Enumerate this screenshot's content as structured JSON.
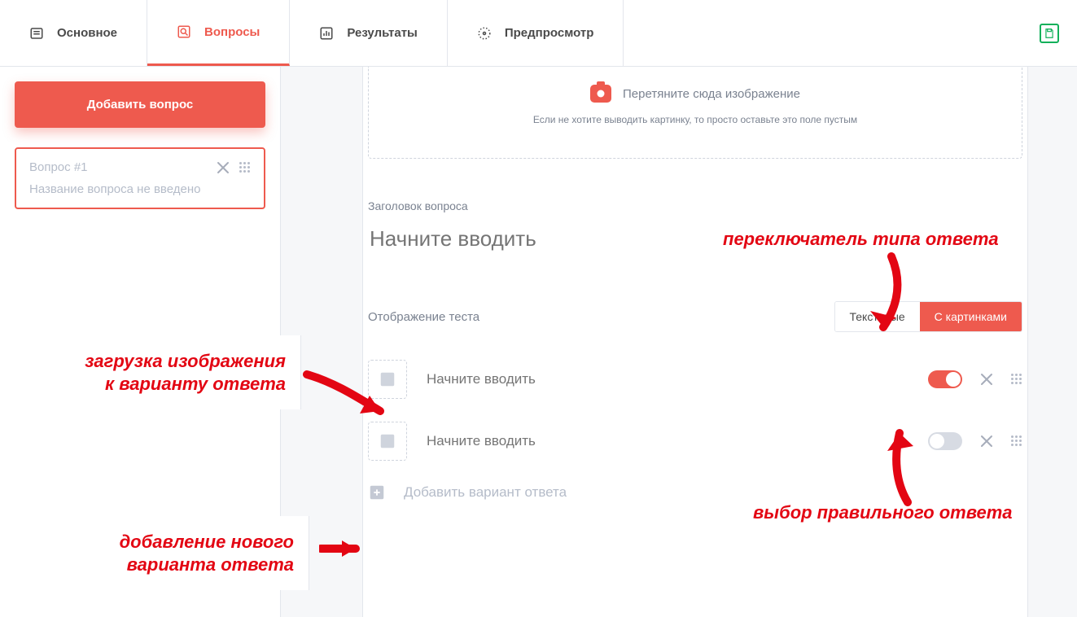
{
  "tabs": {
    "main": "Основное",
    "questions": "Вопросы",
    "results": "Результаты",
    "preview": "Предпросмотр"
  },
  "left": {
    "add_button": "Добавить вопрос",
    "question_card": {
      "title": "Вопрос #1",
      "subtitle": "Название вопроса не введено"
    }
  },
  "dropzone": {
    "line": "Перетяните сюда изображение",
    "hint": "Если не хотите выводить картинку, то просто оставьте это поле пустым"
  },
  "title_field": {
    "label": "Заголовок вопроса",
    "placeholder": "Начните вводить"
  },
  "display": {
    "label": "Отображение теста",
    "option_text": "Текстовые",
    "option_images": "С картинками"
  },
  "answers": [
    {
      "placeholder": "Начните вводить",
      "correct": true
    },
    {
      "placeholder": "Начните вводить",
      "correct": false
    }
  ],
  "add_answer": "Добавить вариант ответа",
  "annotations": {
    "type_switch": "переключатель типа ответа",
    "upload_image_l1": "загрузка изображения",
    "upload_image_l2": "к варианту ответа",
    "correct_pick": "выбор правильного ответа",
    "add_new_l1": "добавление нового",
    "add_new_l2": "варианта ответа"
  }
}
